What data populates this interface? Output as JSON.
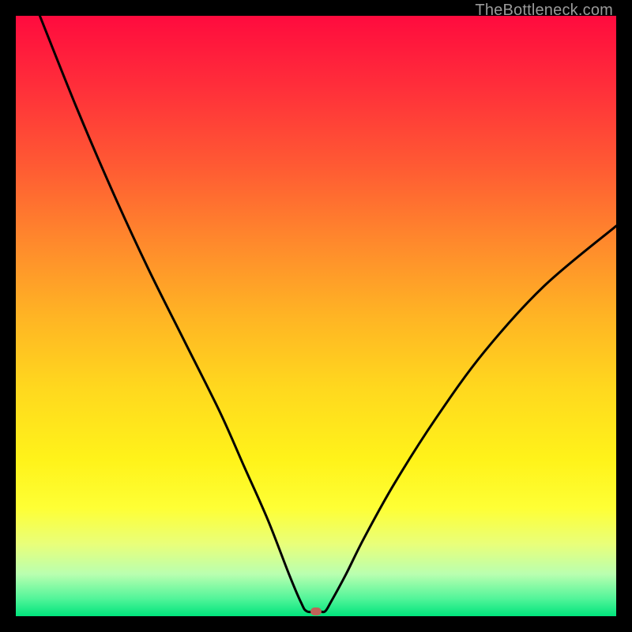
{
  "watermark": "TheBottleneck.com",
  "colors": {
    "frame": "#000000",
    "curve": "#000000",
    "marker": "#c06258"
  },
  "chart_data": {
    "type": "line",
    "title": "",
    "xlabel": "",
    "ylabel": "",
    "xlim": [
      0,
      100
    ],
    "ylim": [
      0,
      100
    ],
    "grid": false,
    "series": [
      {
        "name": "bottleneck-curve",
        "x": [
          4,
          10,
          16,
          22,
          28,
          34,
          38,
          42,
          45.5,
          47.5,
          48.5,
          50.5,
          51.5,
          52.5,
          55,
          58,
          63,
          70,
          78,
          88,
          100
        ],
        "values": [
          100,
          85,
          71,
          58,
          46,
          34,
          25,
          16,
          7,
          2.3,
          0.8,
          0.8,
          0.8,
          2.4,
          7,
          13,
          22,
          33,
          44,
          55,
          65
        ]
      }
    ],
    "annotations": [
      {
        "name": "min-marker",
        "x": 50,
        "y": 0.8
      }
    ],
    "background_gradient": {
      "stops": [
        {
          "pos": 0,
          "color": "#ff0b3e"
        },
        {
          "pos": 25,
          "color": "#ff5a33"
        },
        {
          "pos": 50,
          "color": "#ffb424"
        },
        {
          "pos": 74,
          "color": "#fff31a"
        },
        {
          "pos": 100,
          "color": "#00e47c"
        }
      ]
    }
  }
}
